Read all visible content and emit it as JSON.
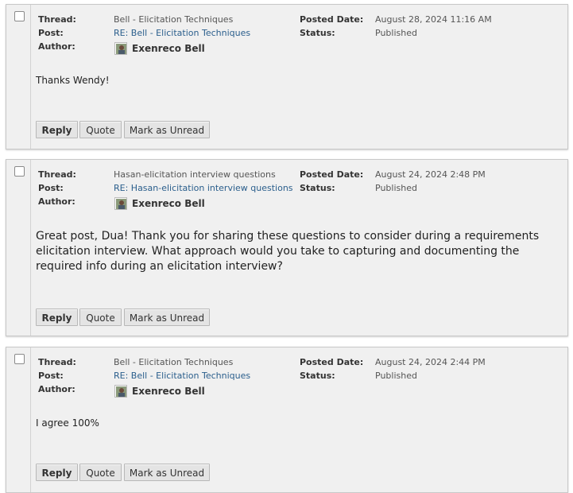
{
  "labels": {
    "thread": "Thread:",
    "post": "Post:",
    "author": "Author:",
    "posted_date": "Posted Date:",
    "status": "Status:"
  },
  "buttons": {
    "reply": "Reply",
    "quote": "Quote",
    "mark_unread": "Mark as Unread"
  },
  "posts": [
    {
      "thread": "Bell - Elicitation Techniques",
      "post": "RE: Bell - Elicitation Techniques",
      "author": "Exenreco Bell",
      "posted_date": "August 28, 2024 11:16 AM",
      "status": "Published",
      "body": "Thanks Wendy!"
    },
    {
      "thread": "Hasan-elicitation interview questions",
      "post": "RE: Hasan-elicitation interview questions",
      "author": "Exenreco Bell",
      "posted_date": "August 24, 2024 2:48 PM",
      "status": "Published",
      "body": "Great post, Dua! Thank you for sharing these questions to consider during a requirements elicitation interview. What approach would you take to capturing and documenting the required info during an elicitation interview?"
    },
    {
      "thread": "Bell - Elicitation Techniques",
      "post": "RE: Bell - Elicitation Techniques",
      "author": "Exenreco Bell",
      "posted_date": "August 24, 2024 2:44 PM",
      "status": "Published",
      "body": "I agree 100%"
    }
  ],
  "icons": {
    "checkbox": "checkbox-icon",
    "avatar": "avatar-icon"
  },
  "colors": {
    "link": "#2a5e8c",
    "panel": "#f0f0f0",
    "button": "#e4e4e4"
  }
}
